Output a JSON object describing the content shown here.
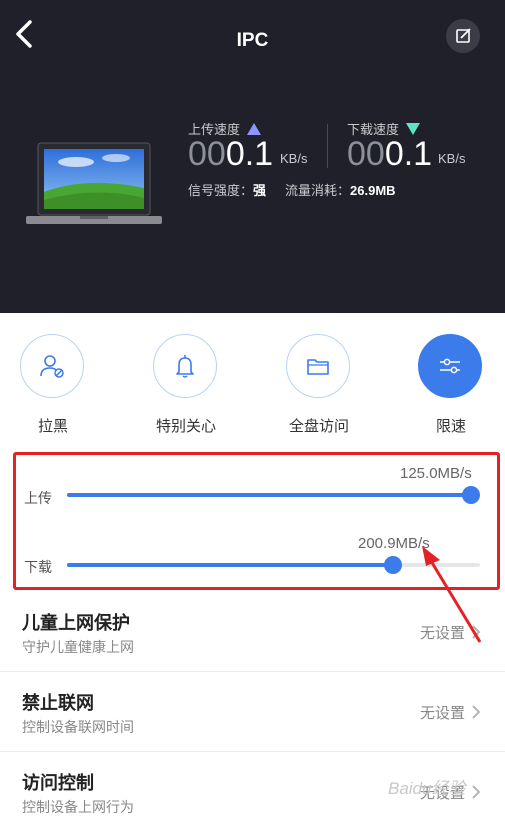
{
  "header": {
    "title": "IPC",
    "upload": {
      "label": "上传速度",
      "zeros": "00",
      "value": "0.1",
      "unit": "KB/s"
    },
    "download": {
      "label": "下载速度",
      "zeros": "00",
      "value": "0.1",
      "unit": "KB/s"
    },
    "signal": {
      "label": "信号强度：",
      "value": "强"
    },
    "traffic": {
      "label": "流量消耗：",
      "value": "26.9MB"
    }
  },
  "actions": [
    {
      "label": "拉黑",
      "icon": "user-block-icon"
    },
    {
      "label": "特别关心",
      "icon": "bell-icon"
    },
    {
      "label": "全盘访问",
      "icon": "folder-icon"
    },
    {
      "label": "限速",
      "icon": "sliders-icon",
      "active": true
    }
  ],
  "speed_limit": {
    "upload": {
      "label": "上传",
      "value": "125.0MB/s",
      "fraction": 1.0
    },
    "download": {
      "label": "下载",
      "value": "200.9MB/s",
      "fraction": 0.79
    }
  },
  "list": [
    {
      "title": "儿童上网保护",
      "subtitle": "守护儿童健康上网",
      "value": "无设置"
    },
    {
      "title": "禁止联网",
      "subtitle": "控制设备联网时间",
      "value": "无设置"
    },
    {
      "title": "访问控制",
      "subtitle": "控制设备上网行为",
      "value": "无设置"
    }
  ],
  "colors": {
    "accent": "#3b7bea",
    "header_bg": "#1f2029",
    "highlight": "#e42127",
    "upload_arrow": "#8f95ff",
    "download_arrow": "#5fe3c6"
  },
  "watermark": "Baidu经验"
}
